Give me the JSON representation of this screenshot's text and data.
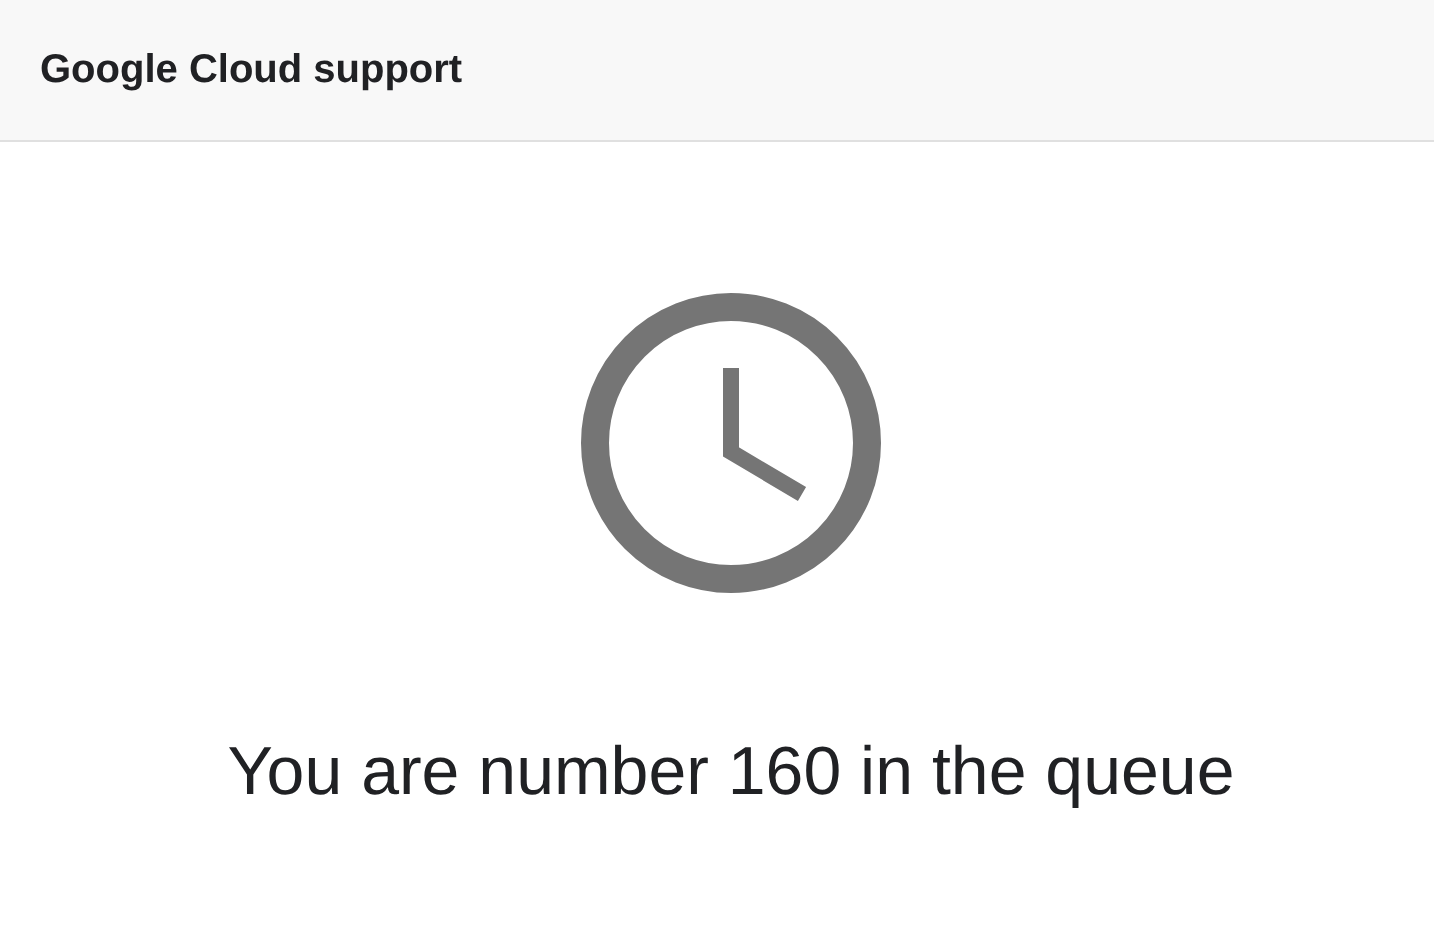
{
  "header": {
    "title": "Google Cloud support"
  },
  "message": "You are number 160 in the queue"
}
